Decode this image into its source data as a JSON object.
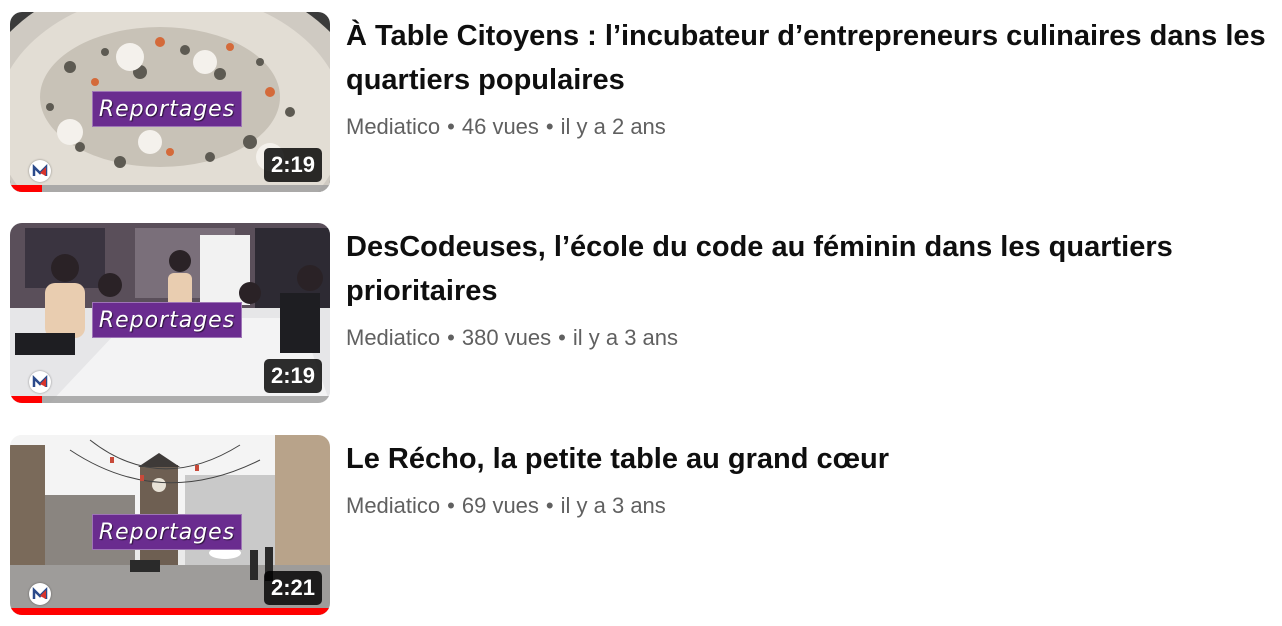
{
  "badge_label": "Reportages",
  "colors": {
    "badge_bg": "#6a2c8f",
    "progress_fill": "#ff0000",
    "title_text": "#0f0f0f",
    "meta_text": "#606060"
  },
  "separator": "•",
  "videos": [
    {
      "title": "À Table Citoyens : l’incubateur d’entrepreneurs culinaires dans les quartiers populaires",
      "channel": "Mediatico",
      "views": "46 vues",
      "age": "il y a 2 ans",
      "duration": "2:19",
      "watched_fraction": 0.1,
      "thumbnail_icon": "plated-food-thumbnail"
    },
    {
      "title": "DesCodeuses, l’école du code au féminin dans les quartiers prioritaires",
      "channel": "Mediatico",
      "views": "380 vues",
      "age": "il y a 3 ans",
      "duration": "2:19",
      "watched_fraction": 0.1,
      "thumbnail_icon": "classroom-thumbnail"
    },
    {
      "title": "Le Récho, la petite table au grand cœur",
      "channel": "Mediatico",
      "views": "69 vues",
      "age": "il y a 3 ans",
      "duration": "2:21",
      "watched_fraction": 1.0,
      "thumbnail_icon": "town-square-thumbnail"
    }
  ]
}
